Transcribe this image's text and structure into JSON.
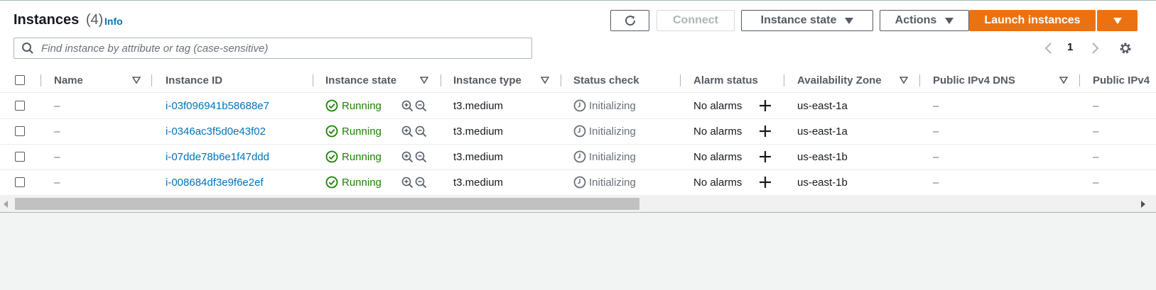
{
  "header": {
    "title": "Instances",
    "count": "(4)",
    "info": "Info"
  },
  "toolbar": {
    "connect": "Connect",
    "instance_state": "Instance state",
    "actions": "Actions",
    "launch": "Launch instances"
  },
  "search": {
    "placeholder": "Find instance by attribute or tag (case-sensitive)",
    "value": ""
  },
  "pagination": {
    "current_page": "1"
  },
  "table": {
    "columns": [
      "Name",
      "Instance ID",
      "Instance state",
      "Instance type",
      "Status check",
      "Alarm status",
      "Availability Zone",
      "Public IPv4 DNS",
      "Public IPv4"
    ],
    "rows": [
      {
        "name": "–",
        "id": "i-03f096941b58688e7",
        "state": "Running",
        "type": "t3.medium",
        "status": "Initializing",
        "alarm": "No alarms",
        "az": "us-east-1a",
        "dns": "–",
        "ipv4": "–"
      },
      {
        "name": "–",
        "id": "i-0346ac3f5d0e43f02",
        "state": "Running",
        "type": "t3.medium",
        "status": "Initializing",
        "alarm": "No alarms",
        "az": "us-east-1a",
        "dns": "–",
        "ipv4": "–"
      },
      {
        "name": "–",
        "id": "i-07dde78b6e1f47ddd",
        "state": "Running",
        "type": "t3.medium",
        "status": "Initializing",
        "alarm": "No alarms",
        "az": "us-east-1b",
        "dns": "–",
        "ipv4": "–"
      },
      {
        "name": "–",
        "id": "i-008684df3e9f6e2ef",
        "state": "Running",
        "type": "t3.medium",
        "status": "Initializing",
        "alarm": "No alarms",
        "az": "us-east-1b",
        "dns": "–",
        "ipv4": "–"
      }
    ]
  },
  "icons": {
    "refresh": "refresh-icon",
    "search": "search-icon",
    "settings": "gear-icon",
    "running": "check-circle-icon",
    "status": "clock-icon",
    "zoom_in": "zoom-in-icon",
    "zoom_out": "zoom-out-icon",
    "add_alarm": "plus-icon"
  },
  "colors": {
    "primary": "#ec7211",
    "link": "#0073bb",
    "running": "#1d8102",
    "border": "#aab7b8"
  }
}
